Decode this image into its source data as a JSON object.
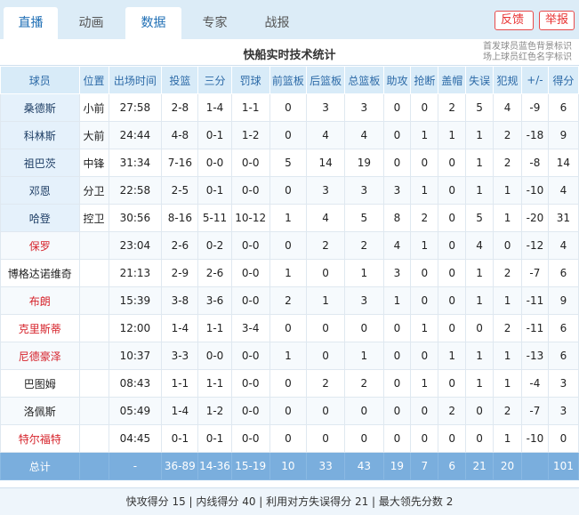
{
  "tabs": [
    {
      "label": "直播",
      "active": true
    },
    {
      "label": "动画",
      "active": false
    },
    {
      "label": "数据",
      "active": true
    },
    {
      "label": "专家",
      "active": false
    },
    {
      "label": "战报",
      "active": false
    }
  ],
  "buttons": {
    "feedback": "反馈",
    "report": "举报"
  },
  "title": "快船实时技术统计",
  "notes": [
    "首发球员蓝色背景标识",
    "场上球员红色名字标识"
  ],
  "columns": [
    "球员",
    "位置",
    "出场时间",
    "投篮",
    "三分",
    "罚球",
    "前篮板",
    "后篮板",
    "总篮板",
    "助攻",
    "抢断",
    "盖帽",
    "失误",
    "犯规",
    "+/-",
    "得分"
  ],
  "players": [
    {
      "name": "桑德斯",
      "pos": "小前",
      "min": "27:58",
      "fg": "2-8",
      "tp": "1-4",
      "ft": "1-1",
      "oreb": "0",
      "dreb": "3",
      "reb": "3",
      "ast": "0",
      "stl": "0",
      "blk": "2",
      "tov": "5",
      "pf": "4",
      "pm": "-9",
      "pts": "6",
      "starter": true,
      "on_court": false
    },
    {
      "name": "科林斯",
      "pos": "大前",
      "min": "24:44",
      "fg": "4-8",
      "tp": "0-1",
      "ft": "1-2",
      "oreb": "0",
      "dreb": "4",
      "reb": "4",
      "ast": "0",
      "stl": "1",
      "blk": "1",
      "tov": "1",
      "pf": "2",
      "pm": "-18",
      "pts": "9",
      "starter": true,
      "on_court": false
    },
    {
      "name": "祖巴茨",
      "pos": "中锋",
      "min": "31:34",
      "fg": "7-16",
      "tp": "0-0",
      "ft": "0-0",
      "oreb": "5",
      "dreb": "14",
      "reb": "19",
      "ast": "0",
      "stl": "0",
      "blk": "0",
      "tov": "1",
      "pf": "2",
      "pm": "-8",
      "pts": "14",
      "starter": true,
      "on_court": false
    },
    {
      "name": "邓恩",
      "pos": "分卫",
      "min": "22:58",
      "fg": "2-5",
      "tp": "0-1",
      "ft": "0-0",
      "oreb": "0",
      "dreb": "3",
      "reb": "3",
      "ast": "3",
      "stl": "1",
      "blk": "0",
      "tov": "1",
      "pf": "1",
      "pm": "-10",
      "pts": "4",
      "starter": true,
      "on_court": false
    },
    {
      "name": "哈登",
      "pos": "控卫",
      "min": "30:56",
      "fg": "8-16",
      "tp": "5-11",
      "ft": "10-12",
      "oreb": "1",
      "dreb": "4",
      "reb": "5",
      "ast": "8",
      "stl": "2",
      "blk": "0",
      "tov": "5",
      "pf": "1",
      "pm": "-20",
      "pts": "31",
      "starter": true,
      "on_court": false
    },
    {
      "name": "保罗",
      "pos": "",
      "min": "23:04",
      "fg": "2-6",
      "tp": "0-2",
      "ft": "0-0",
      "oreb": "0",
      "dreb": "2",
      "reb": "2",
      "ast": "4",
      "stl": "1",
      "blk": "0",
      "tov": "4",
      "pf": "0",
      "pm": "-12",
      "pts": "4",
      "starter": false,
      "on_court": true
    },
    {
      "name": "博格达诺维奇",
      "pos": "",
      "min": "21:13",
      "fg": "2-9",
      "tp": "2-6",
      "ft": "0-0",
      "oreb": "1",
      "dreb": "0",
      "reb": "1",
      "ast": "3",
      "stl": "0",
      "blk": "0",
      "tov": "1",
      "pf": "2",
      "pm": "-7",
      "pts": "6",
      "starter": false,
      "on_court": false
    },
    {
      "name": "布朗",
      "pos": "",
      "min": "15:39",
      "fg": "3-8",
      "tp": "3-6",
      "ft": "0-0",
      "oreb": "2",
      "dreb": "1",
      "reb": "3",
      "ast": "1",
      "stl": "0",
      "blk": "0",
      "tov": "1",
      "pf": "1",
      "pm": "-11",
      "pts": "9",
      "starter": false,
      "on_court": true
    },
    {
      "name": "克里斯蒂",
      "pos": "",
      "min": "12:00",
      "fg": "1-4",
      "tp": "1-1",
      "ft": "3-4",
      "oreb": "0",
      "dreb": "0",
      "reb": "0",
      "ast": "0",
      "stl": "1",
      "blk": "0",
      "tov": "0",
      "pf": "2",
      "pm": "-11",
      "pts": "6",
      "starter": false,
      "on_court": true
    },
    {
      "name": "尼德豪泽",
      "pos": "",
      "min": "10:37",
      "fg": "3-3",
      "tp": "0-0",
      "ft": "0-0",
      "oreb": "1",
      "dreb": "0",
      "reb": "1",
      "ast": "0",
      "stl": "0",
      "blk": "1",
      "tov": "1",
      "pf": "1",
      "pm": "-13",
      "pts": "6",
      "starter": false,
      "on_court": true
    },
    {
      "name": "巴图姆",
      "pos": "",
      "min": "08:43",
      "fg": "1-1",
      "tp": "1-1",
      "ft": "0-0",
      "oreb": "0",
      "dreb": "2",
      "reb": "2",
      "ast": "0",
      "stl": "1",
      "blk": "0",
      "tov": "1",
      "pf": "1",
      "pm": "-4",
      "pts": "3",
      "starter": false,
      "on_court": false
    },
    {
      "name": "洛佩斯",
      "pos": "",
      "min": "05:49",
      "fg": "1-4",
      "tp": "1-2",
      "ft": "0-0",
      "oreb": "0",
      "dreb": "0",
      "reb": "0",
      "ast": "0",
      "stl": "0",
      "blk": "2",
      "tov": "0",
      "pf": "2",
      "pm": "-7",
      "pts": "3",
      "starter": false,
      "on_court": false
    },
    {
      "name": "特尔福特",
      "pos": "",
      "min": "04:45",
      "fg": "0-1",
      "tp": "0-1",
      "ft": "0-0",
      "oreb": "0",
      "dreb": "0",
      "reb": "0",
      "ast": "0",
      "stl": "0",
      "blk": "0",
      "tov": "0",
      "pf": "1",
      "pm": "-10",
      "pts": "0",
      "starter": false,
      "on_court": true
    }
  ],
  "total": {
    "label": "总计",
    "pos": "",
    "min": "-",
    "fg": "36-89",
    "tp": "14-36",
    "ft": "15-19",
    "oreb": "10",
    "dreb": "33",
    "reb": "43",
    "ast": "19",
    "stl": "7",
    "blk": "6",
    "tov": "21",
    "pf": "20",
    "pm": "",
    "pts": "101"
  },
  "footer": "快攻得分 15 | 内线得分 40 | 利用对方失误得分 21 | 最大领先分数 2",
  "colors": {
    "tab_bg": "#dcecf7",
    "header_bg": "#d8ebf8",
    "header_text": "#2c6aa7",
    "starter_bg": "#e5f1fb",
    "on_court_name": "#d6232b",
    "total_bg": "#7aaedd",
    "button_red": "#e83030"
  }
}
